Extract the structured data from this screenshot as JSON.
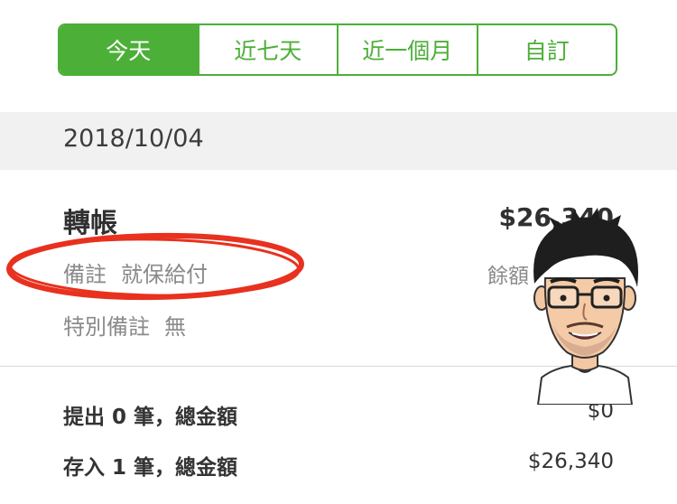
{
  "tabs": [
    {
      "label": "今天",
      "active": true
    },
    {
      "label": "近七天",
      "active": false
    },
    {
      "label": "近一個月",
      "active": false
    },
    {
      "label": "自訂",
      "active": false
    }
  ],
  "date": "2018/10/04",
  "transaction": {
    "title": "轉帳",
    "amount": "$26,340",
    "note_label": "備註",
    "note_value": "就保給付",
    "balance_label": "餘額",
    "special_note_label": "特別備註",
    "special_note_value": "無"
  },
  "summary": {
    "withdraw_label": "提出 0 筆，總金額",
    "withdraw_value": "$0",
    "deposit_label": "存入 1 筆，總金額",
    "deposit_value": "$26,340"
  },
  "colors": {
    "accent": "#4caf38",
    "annotation": "#e8311e"
  }
}
